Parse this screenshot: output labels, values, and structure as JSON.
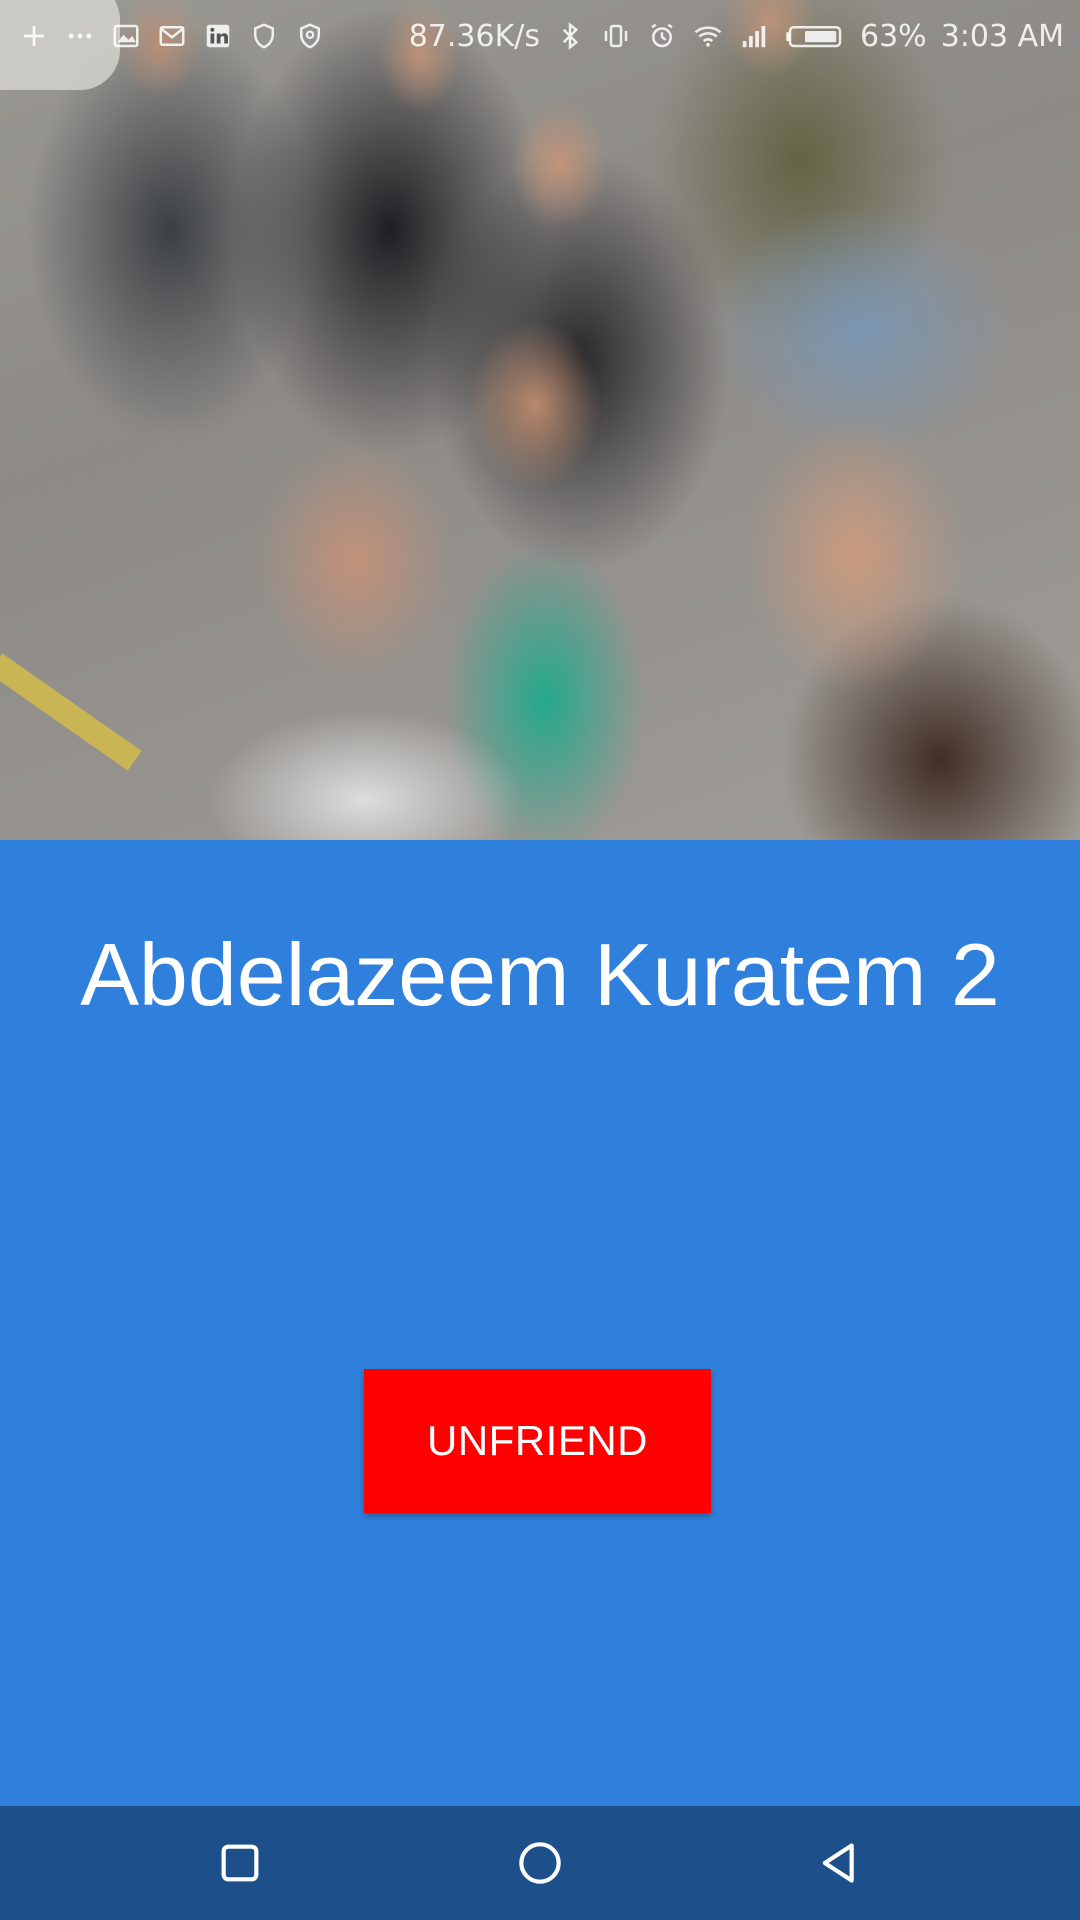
{
  "status_bar": {
    "network_speed": "87.36K/s",
    "battery_percent": "63%",
    "time": "3:03 AM",
    "icons_left": [
      "add-icon",
      "more-dots-icon",
      "gallery-icon",
      "gmail-icon",
      "linkedin-icon",
      "shield-icon",
      "shield-check-icon"
    ],
    "icons_right": [
      "bluetooth-icon",
      "vibrate-icon",
      "alarm-icon",
      "wifi-icon",
      "signal-icon",
      "battery-icon"
    ]
  },
  "profile": {
    "photo": "group-selfie-photo",
    "name": "Abdelazeem Kuratem 2"
  },
  "actions": {
    "unfriend_label": "UNFRIEND",
    "unfriend_color": "#ff0000"
  },
  "theme": {
    "background": "#2f80dd",
    "nav_bar": "#1d4f8a"
  },
  "nav_bar": {
    "buttons": [
      "recents-square-icon",
      "home-circle-icon",
      "back-triangle-icon"
    ]
  }
}
